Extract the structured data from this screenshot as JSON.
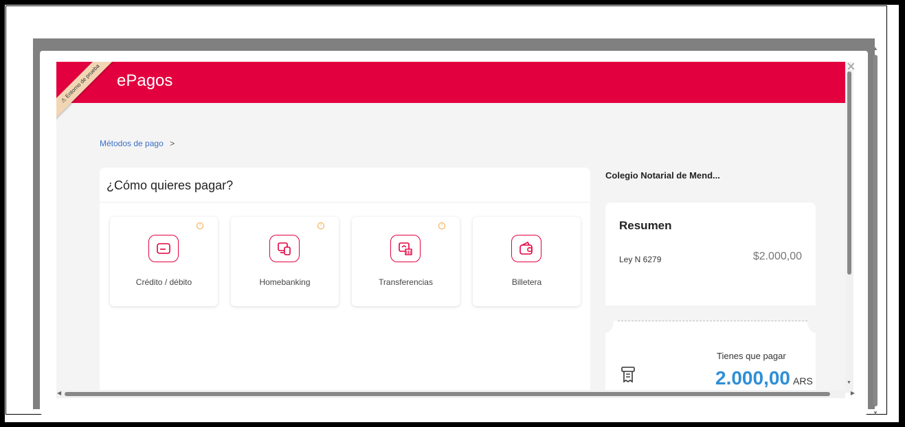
{
  "header": {
    "brand": "ePagos",
    "ribbon": "Entorno de prueba"
  },
  "modal": {
    "close_label": "×"
  },
  "breadcrumb": {
    "label": "Métodos de pago",
    "separator": ">"
  },
  "main": {
    "title": "¿Cómo quieres pagar?",
    "methods": [
      {
        "label": "Crédito / débito",
        "icon": "credit-card-icon",
        "info": true
      },
      {
        "label": "Homebanking",
        "icon": "homebanking-icon",
        "info": true
      },
      {
        "label": "Transferencias",
        "icon": "bank-transfer-icon",
        "info": true
      },
      {
        "label": "Billetera",
        "icon": "wallet-icon",
        "info": false
      }
    ]
  },
  "summary": {
    "merchant": "Colegio Notarial de Mend...",
    "title": "Resumen",
    "item_label": "Ley N 6279",
    "item_amount": "$2.000,00",
    "pay_label": "Tienes que pagar",
    "pay_amount": "2.000,00",
    "currency": "ARS"
  },
  "colors": {
    "brand": "#e3003f",
    "accent_blue": "#2f8fd6",
    "info_orange": "#f2a33a"
  }
}
